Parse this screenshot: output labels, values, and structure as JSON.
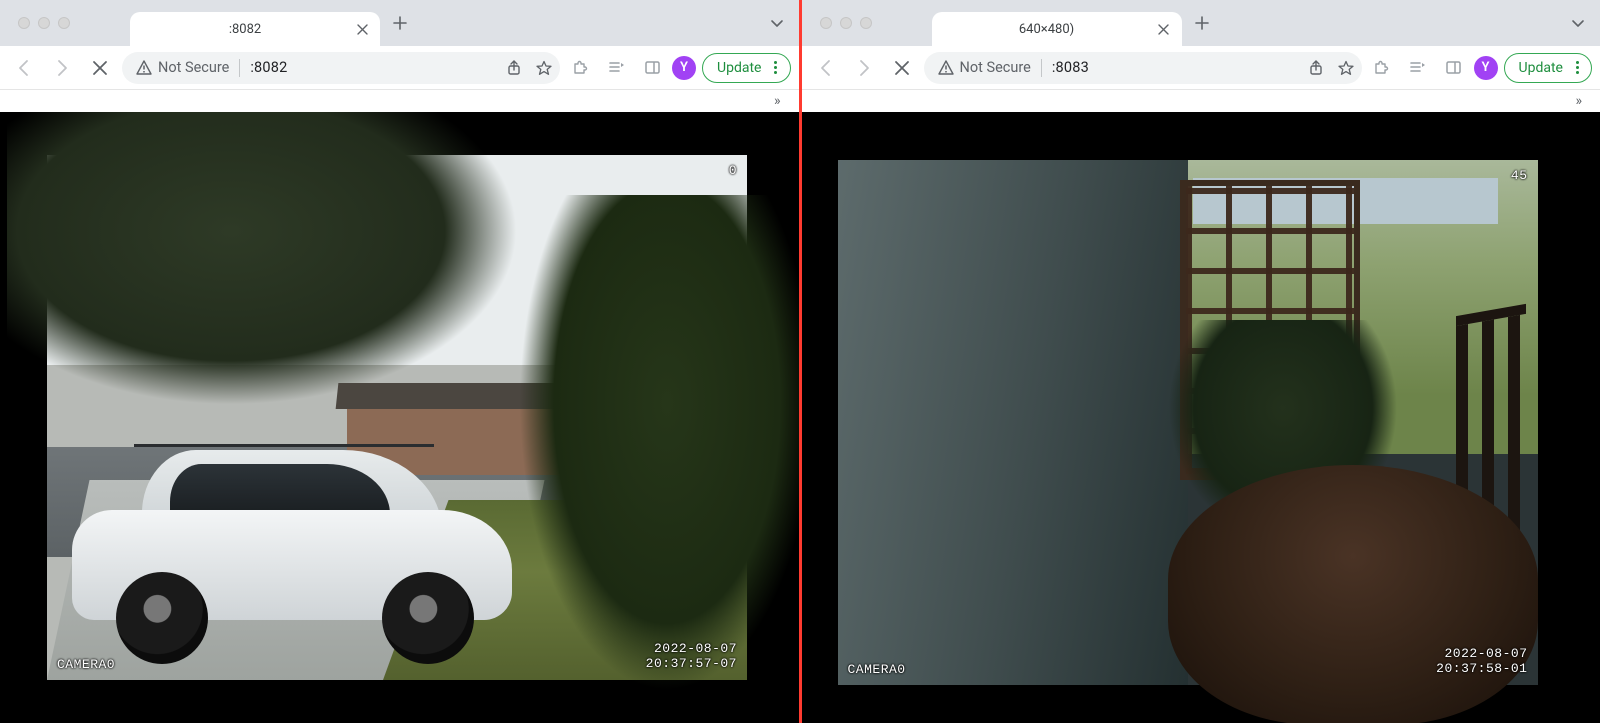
{
  "windows": [
    {
      "tab_title": ":8082",
      "security_label": "Not Secure",
      "url_display": ":8082",
      "update_label": "Update",
      "avatar_letter": "Y",
      "overflow_glyph": "»",
      "camera": {
        "top_right": "0",
        "label": "CAMERA0",
        "date": "2022-08-07",
        "time": "20:37:57-07"
      }
    },
    {
      "tab_title": "640×480)",
      "security_label": "Not Secure",
      "url_display": ":8083",
      "update_label": "Update",
      "avatar_letter": "Y",
      "overflow_glyph": "»",
      "camera": {
        "top_right": "45",
        "label": "CAMERA0",
        "date": "2022-08-07",
        "time": "20:37:58-01"
      }
    }
  ]
}
